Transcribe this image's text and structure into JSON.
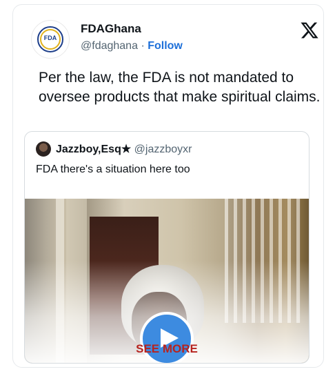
{
  "tweet": {
    "avatar_text": "FDA",
    "display_name": "FDAGhana",
    "handle": "@fdaghana",
    "separator": "·",
    "follow_label": "Follow",
    "text": "Per the law, the FDA is not mandated to oversee products that make spiritual claims."
  },
  "quoted": {
    "display_name": "Jazzboy,Esq★",
    "handle": "@jazzboyxr",
    "text": "FDA there's a situation here too",
    "see_more_label": "SEE MORE"
  },
  "colors": {
    "follow": "#1d6fd9",
    "see_more": "#b6231f",
    "play_button": "#3d8be0"
  },
  "icons": {
    "platform_logo": "x-logo-icon",
    "media_play": "play-icon"
  }
}
